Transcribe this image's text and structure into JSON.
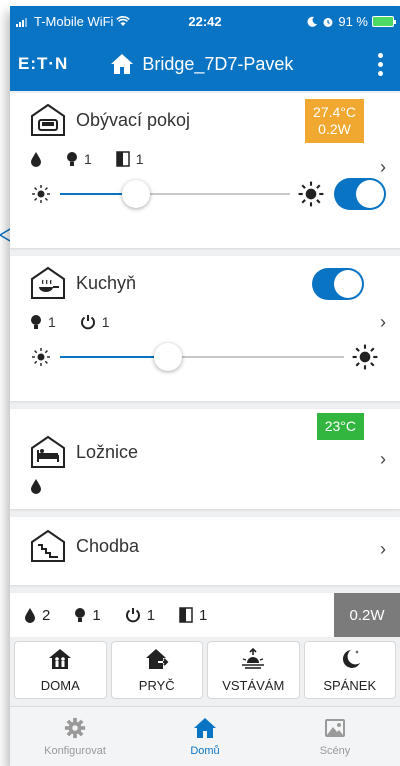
{
  "status_bar": {
    "carrier": "T-Mobile WiFi",
    "time": "22:42",
    "battery": "91 %"
  },
  "header": {
    "logo": "E:T·N",
    "hub_name": "Bridge_7D7-Pavek"
  },
  "rooms": [
    {
      "name": "Obývací pokoj",
      "badge_temp": "27.4°C",
      "badge_power": "0.2W",
      "lights": "1",
      "doors": "1",
      "dimmer_level": 0.33
    },
    {
      "name": "Kuchyň",
      "lights": "1",
      "power": "1",
      "dimmer_level": 0.38
    },
    {
      "name": "Ložnice",
      "badge_temp": "23°C"
    },
    {
      "name": "Chodba"
    }
  ],
  "summary": {
    "water": "2",
    "lights": "1",
    "power": "1",
    "doors": "1",
    "total_power": "0.2W"
  },
  "scenes": [
    {
      "label": "DOMA",
      "icon": "home-people-icon"
    },
    {
      "label": "PRYČ",
      "icon": "home-leave-icon"
    },
    {
      "label": "VSTÁVÁM",
      "icon": "sunrise-icon"
    },
    {
      "label": "SPÁNEK",
      "icon": "moon-icon"
    }
  ],
  "tabs": [
    {
      "label": "Konfigurovat",
      "icon": "gear-icon"
    },
    {
      "label": "Domů",
      "icon": "home-icon"
    },
    {
      "label": "Scény",
      "icon": "image-icon"
    }
  ],
  "colors": {
    "primary": "#0a74c4",
    "badge_orange": "#f0a830",
    "badge_green": "#33b640",
    "power_badge": "#7b7b7b"
  }
}
